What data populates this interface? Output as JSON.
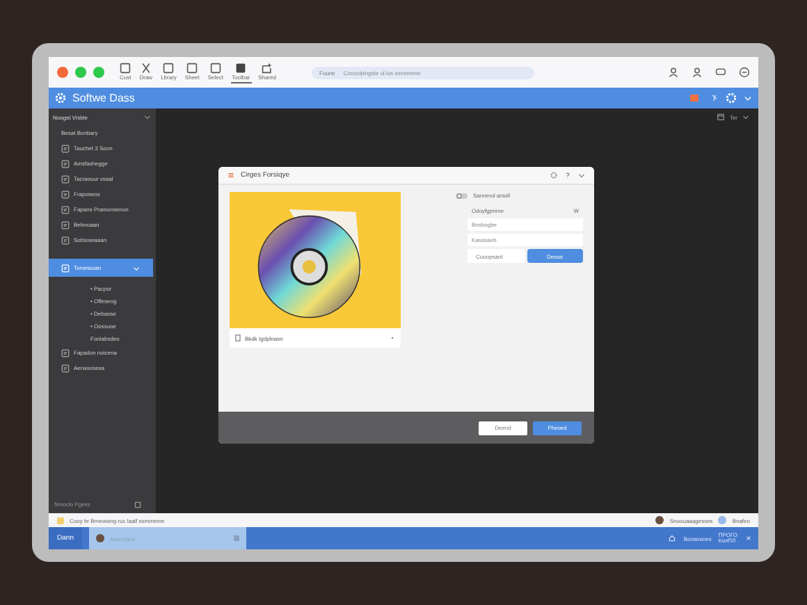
{
  "toolbar": {
    "tools": [
      {
        "label": "Cust",
        "kind": "frame",
        "selected": false
      },
      {
        "label": "Draw",
        "kind": "scissors",
        "selected": false
      },
      {
        "label": "Lbrary",
        "kind": "frame",
        "selected": false
      },
      {
        "label": "Sheet",
        "kind": "frame",
        "selected": false
      },
      {
        "label": "Select",
        "kind": "frame",
        "selected": false
      },
      {
        "label": "Toolbar",
        "kind": "solid",
        "selected": true
      },
      {
        "label": "Shared",
        "kind": "share",
        "selected": false
      }
    ],
    "search": {
      "label": "Fuune",
      "placeholder": "Conoclpingste ul ius ssmmeme"
    }
  },
  "app_bar": {
    "title": "Softwe Dass"
  },
  "sidebar": {
    "header": "Noogst Vrsble",
    "section": "Besat Bonbary",
    "items": [
      {
        "label": "Tauchet 3 Soon",
        "selected": false
      },
      {
        "label": "Amsfashegge",
        "selected": false
      },
      {
        "label": "Tacraouur vsaal",
        "selected": false
      },
      {
        "label": "Fraposeos",
        "selected": false
      },
      {
        "label": "Fapans Pramonsenon",
        "selected": false
      },
      {
        "label": "Bebnoaan",
        "selected": false
      },
      {
        "label": "Sobtoseaaan",
        "selected": false
      },
      {
        "label": "Tonsnuuan",
        "selected": true,
        "expanded": true,
        "children": [
          {
            "label": "• Pacpor"
          },
          {
            "label": "• Offeseng"
          },
          {
            "label": "• Debanse"
          },
          {
            "label": "• Oossooe"
          },
          {
            "label": "Fonlabsdeo"
          }
        ]
      },
      {
        "label": "Fapadon noicena",
        "selected": false
      },
      {
        "label": "Aerwoosesa",
        "selected": false
      }
    ],
    "footer": "Nmoclo Pgess"
  },
  "main": {
    "filter": "Ter"
  },
  "dialog": {
    "title": "Cirges Forsiqye",
    "caption": "Bkdk  Igdplnasn",
    "toggle": {
      "label": "Sannevd arsoll",
      "on": false
    },
    "select": {
      "value": "Odoyfgpnrne",
      "suffix": "W"
    },
    "fields": [
      {
        "placeholder": "Bnsbogbe"
      },
      {
        "placeholder": "Kasasaeb"
      }
    ],
    "inline_buttons": [
      "Cuoopsant",
      "Deoos"
    ],
    "footer_buttons": [
      "Deend",
      "Pheoed"
    ]
  },
  "status_bar": {
    "left": "Cooy br Bmewwng ruc laalf ssmmeme",
    "user": "Snoouaaagesses",
    "right": "Bnafeo"
  },
  "taskbar": {
    "start": "Dann",
    "task": "Aasonges",
    "right": "Bonsnones",
    "clock": [
      "ПРОГО",
      "КолПЛ"
    ]
  }
}
